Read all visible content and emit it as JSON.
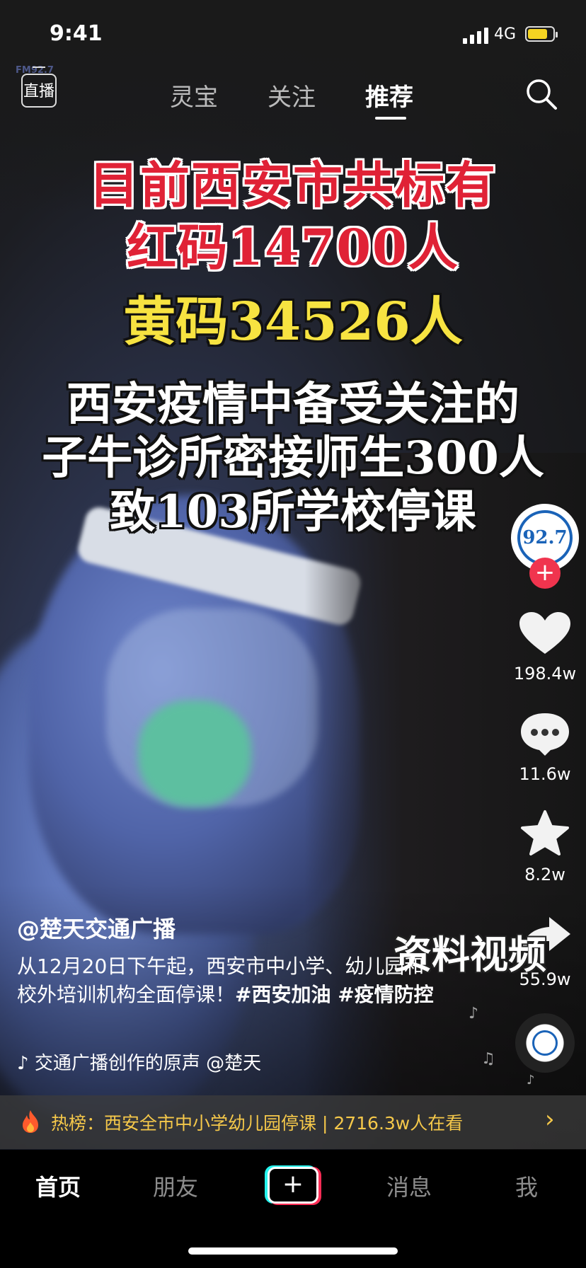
{
  "status_bar": {
    "time": "9:41",
    "network": "4G"
  },
  "top_nav": {
    "live_label": "直播",
    "tabs": [
      {
        "label": "灵宝",
        "active": false
      },
      {
        "label": "关注",
        "active": false
      },
      {
        "label": "推荐",
        "active": true
      }
    ],
    "faint_logo_text": "FM92.7"
  },
  "video": {
    "headline_red": [
      "目前西安市共标有",
      "红码14700人"
    ],
    "headline_yellow": "黄码34526人",
    "headline_white": [
      "西安疫情中备受关注的",
      "子牛诊所密接师生300人",
      "致103所学校停课"
    ],
    "overlay_label": "资料视频"
  },
  "side_rail": {
    "avatar_text": "92.7",
    "follow_symbol": "+",
    "likes": "198.4w",
    "comments": "11.6w",
    "favorites": "8.2w",
    "shares": "55.9w"
  },
  "caption": {
    "author": "@楚天交通广播",
    "description": "从12月20日下午起，西安市中小学、幼儿园和校外培训机构全面停课！",
    "tags": "#西安加油 #疫情防控",
    "music": "交通广播创作的原声    @楚天"
  },
  "hot_banner": {
    "text": "热榜：西安全市中小学幼儿园停课 | 2716.3w人在看",
    "arrow": "›"
  },
  "tab_bar": {
    "items": [
      "首页",
      "朋友",
      "消息",
      "我"
    ],
    "add_symbol": "+"
  },
  "colors": {
    "accent_red": "#e02236",
    "accent_yellow": "#f7e341",
    "follow_red": "#f0344e",
    "hot_text": "#f5c84a"
  }
}
